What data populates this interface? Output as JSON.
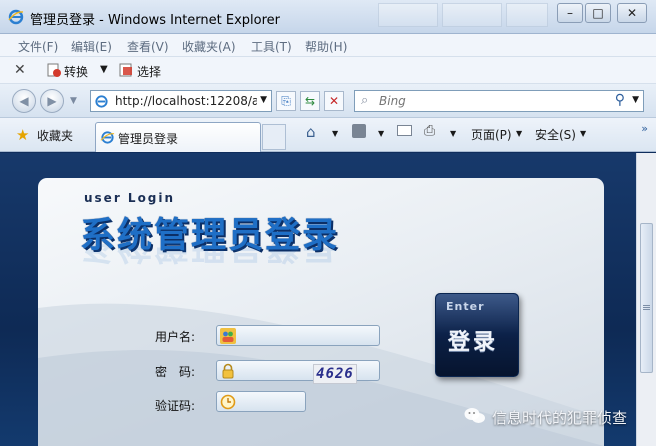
{
  "window": {
    "title": "管理员登录 - Windows Internet Explorer",
    "minimize_label": "–",
    "maximize_label": "□",
    "close_label": "✕"
  },
  "menu": [
    "文件(F)",
    "编辑(E)",
    "查看(V)",
    "收藏夹(A)",
    "工具(T)",
    "帮助(H)"
  ],
  "convert_toolbar": {
    "close_label": "✕",
    "convert_label": "转换",
    "select_label": "选择"
  },
  "address_bar": {
    "url": "http://localhost:12208/a"
  },
  "search": {
    "placeholder": "Bing"
  },
  "favorites_bar": {
    "favorites_label": "收藏夹",
    "tab_title": "管理员登录",
    "page_menu": "页面(P)",
    "safety_menu": "安全(S)"
  },
  "login": {
    "header_en": "user Login",
    "title": "系统管理员登录",
    "username_label": "用户名:",
    "password_label": "密　码:",
    "captcha_label": "验证码:",
    "captcha_value": "4626",
    "username_value": "",
    "password_value": "",
    "captcha_input_value": "",
    "button_enter": "Enter",
    "button_text": "登录"
  },
  "watermark": {
    "text": "信息时代的犯罪侦查"
  },
  "colors": {
    "page_background": "#0f2d5c",
    "title_blue": "#1f6fc6",
    "chrome": "#dfe9f5"
  }
}
